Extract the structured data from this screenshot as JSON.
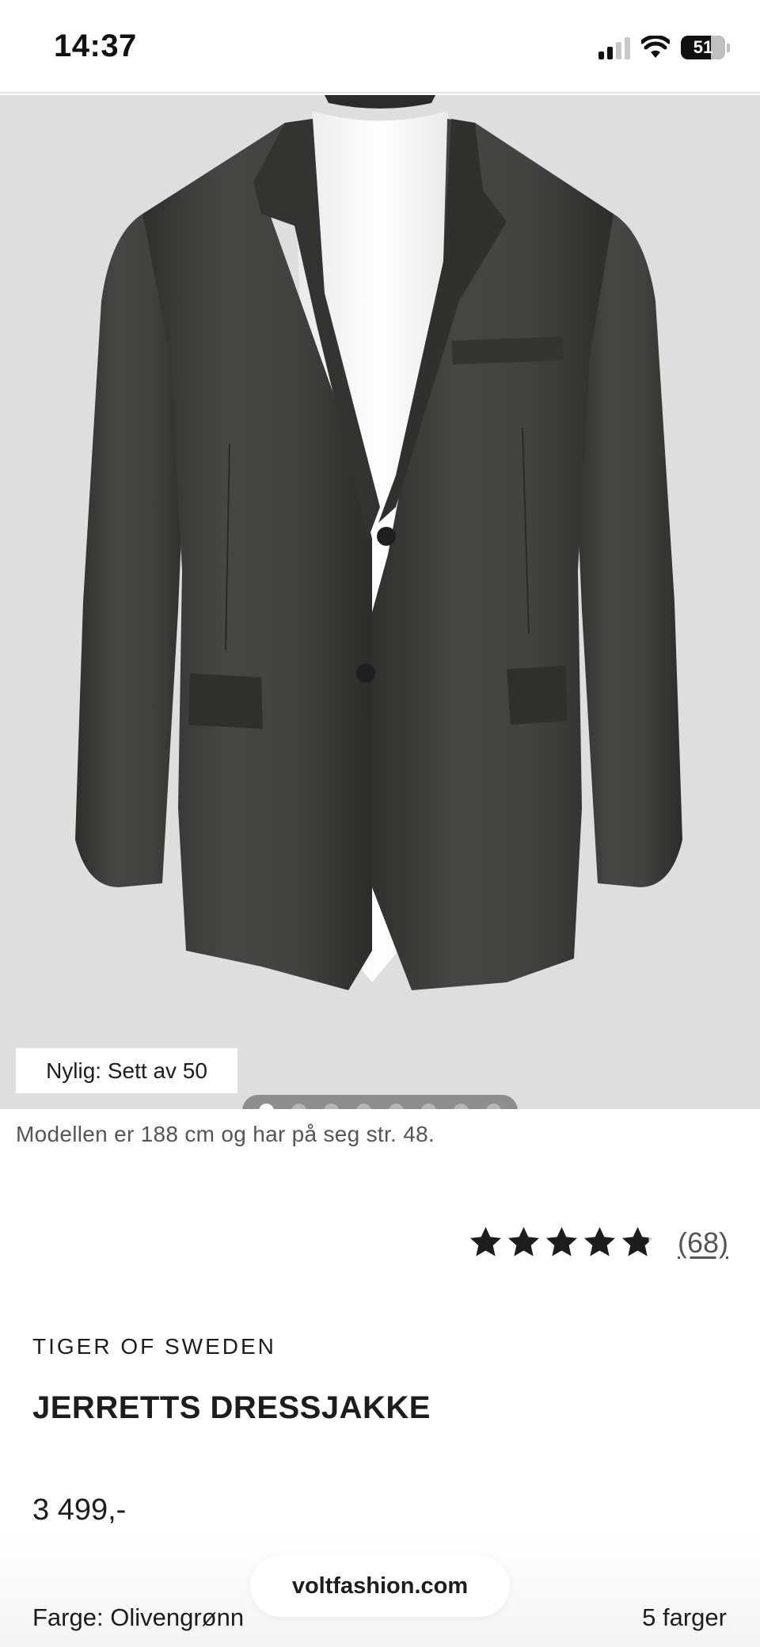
{
  "status_bar": {
    "time": "14:37",
    "battery_percent": "51",
    "icons": [
      "signal-icon",
      "wifi-icon",
      "battery-icon"
    ]
  },
  "gallery": {
    "image_subject": "jacket-photo",
    "slide_count": 8,
    "active_slide": 1,
    "recent_badge": "Nylig: Sett av 50"
  },
  "product": {
    "model_note": "Modellen er 188 cm og har på seg str. 48.",
    "rating_stars": 4.8,
    "review_count": "(68)",
    "brand": "TIGER OF SWEDEN",
    "title": "JERRETTS DRESSJAKKE",
    "price": "3 499,-",
    "color_label": "Farge: Olivengrønn",
    "color_count": "5 farger"
  },
  "browser": {
    "url": "voltfashion.com"
  },
  "colors": {
    "image_background": "#dedede",
    "jacket": "#3a3b39",
    "text": "#1d1d1f",
    "muted_text": "#555555"
  }
}
